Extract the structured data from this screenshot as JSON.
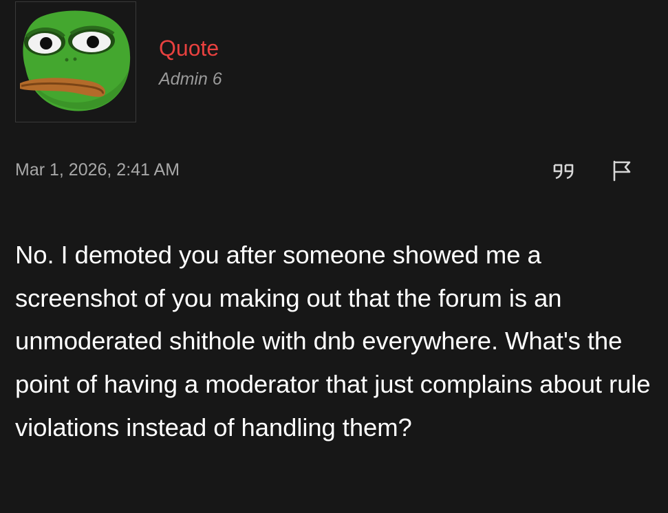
{
  "post": {
    "author": {
      "name": "Quote",
      "title": "Admin 6",
      "avatar": "pepe-frog-avatar",
      "name_color": "#e8413f"
    },
    "date": "Mar 1, 2026, 2:41 AM",
    "actions": [
      {
        "icon": "quote-icon"
      },
      {
        "icon": "flag-icon"
      }
    ],
    "body": "No. I demoted you after someone showed me a screenshot of you making out that the forum is an unmoderated shithole with dnb everywhere. What's the point of having a moderator that just complains about rule violations instead of handling them?"
  }
}
